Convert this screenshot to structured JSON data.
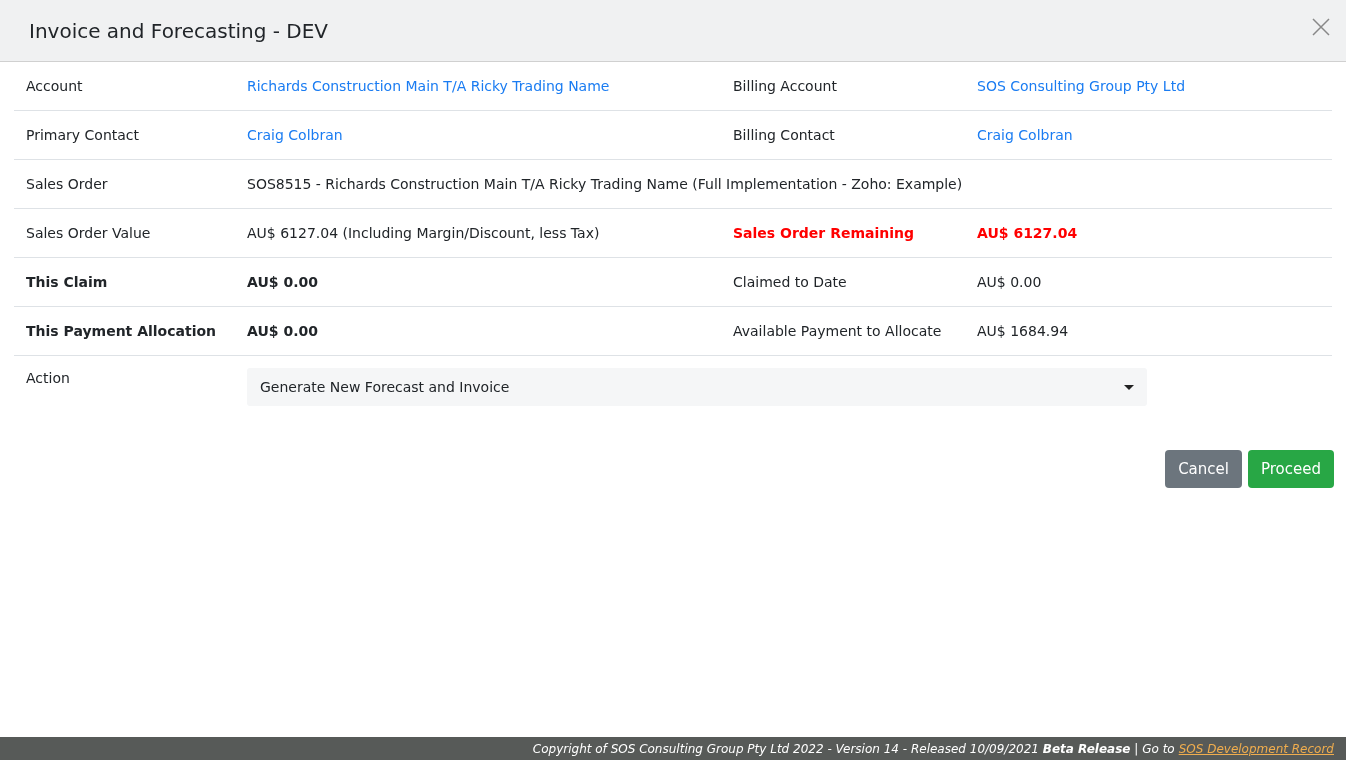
{
  "window": {
    "title": "Invoice and Forecasting - DEV"
  },
  "rows": [
    {
      "cells": [
        {
          "text": "Account",
          "kind": "plain"
        },
        {
          "text": "Richards Construction Main T/A Ricky Trading Name",
          "kind": "link"
        },
        {
          "text": "Billing Account",
          "kind": "plain"
        },
        {
          "text": "SOS Consulting Group Pty Ltd",
          "kind": "link"
        }
      ]
    },
    {
      "cells": [
        {
          "text": "Primary Contact",
          "kind": "plain"
        },
        {
          "text": "Craig Colbran",
          "kind": "link"
        },
        {
          "text": "Billing Contact",
          "kind": "plain"
        },
        {
          "text": "Craig Colbran",
          "kind": "link"
        }
      ]
    },
    {
      "cells": [
        {
          "text": "Sales Order",
          "kind": "plain"
        },
        {
          "text": "SOS8515 - Richards Construction Main T/A Ricky Trading Name (Full Implementation - Zoho: Example)",
          "kind": "plain"
        }
      ]
    },
    {
      "cells": [
        {
          "text": "Sales Order Value",
          "kind": "plain"
        },
        {
          "text": "AU$ 6127.04 (Including Margin/Discount, less Tax)",
          "kind": "plain"
        },
        {
          "text": "Sales Order Remaining",
          "kind": "alert"
        },
        {
          "text": "AU$ 6127.04",
          "kind": "alert"
        }
      ]
    },
    {
      "cells": [
        {
          "text": "This Claim",
          "kind": "bold"
        },
        {
          "text": "AU$ 0.00",
          "kind": "bold"
        },
        {
          "text": "Claimed to Date",
          "kind": "plain"
        },
        {
          "text": "AU$ 0.00",
          "kind": "plain"
        }
      ]
    },
    {
      "cells": [
        {
          "text": "This Payment Allocation",
          "kind": "bold"
        },
        {
          "text": "AU$ 0.00",
          "kind": "bold"
        },
        {
          "text": "Available Payment to Allocate",
          "kind": "plain"
        },
        {
          "text": "AU$ 1684.94",
          "kind": "plain"
        }
      ]
    }
  ],
  "action": {
    "label": "Action",
    "value": "Generate New Forecast and Invoice"
  },
  "buttons": [
    {
      "label": "Cancel",
      "kind": "secondary"
    },
    {
      "label": "Proceed",
      "kind": "primary"
    }
  ],
  "footer": {
    "text": "Copyright of SOS Consulting Group Pty Ltd 2022 - Version 14 - Released 10/09/2021 **Beta Release** | Go to",
    "link": "SOS Development Record"
  }
}
